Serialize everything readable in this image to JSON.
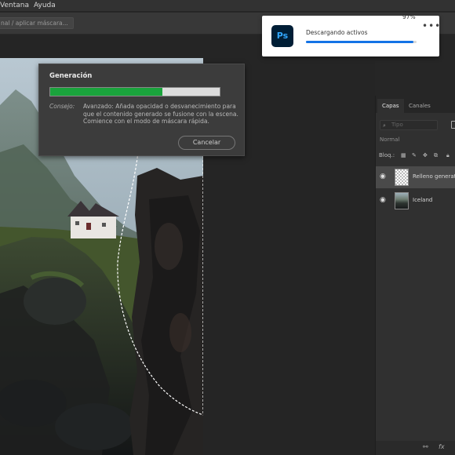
{
  "menubar": {
    "items": [
      "Ventana",
      "Ayuda"
    ]
  },
  "optionsbar": {
    "field_text": "nal / aplicar máscara..."
  },
  "generation_dialog": {
    "title": "Generación",
    "progress_percent": 66,
    "tip_label": "Consejo:",
    "tip_text": "Avanzado: Añada opacidad o desvanecimiento para que el contenido generado se fusione con la escena. Comience con el modo de máscara rápida.",
    "cancel_label": "Cancelar",
    "colors": {
      "progress": "#1aa33c"
    }
  },
  "download_card": {
    "app_logo_text": "Ps",
    "label": "Descargando activos",
    "percent_label": "97%",
    "progress_percent": 97,
    "more_icon": "ellipsis-icon",
    "colors": {
      "progress": "#1473e6",
      "logo_bg": "#001e36",
      "logo_fg": "#31a8ff"
    }
  },
  "layers_panel": {
    "tabs": [
      {
        "label": "Capas"
      },
      {
        "label": "Canales"
      }
    ],
    "filter_placeholder": "Tipo",
    "blend_mode": "Normal",
    "lock_label": "Bloq.:",
    "layers": [
      {
        "name": "Relleno generativo",
        "selected": true,
        "thumb": "checker"
      },
      {
        "name": "Iceland",
        "selected": false,
        "thumb": "photo"
      }
    ],
    "footer_icons": [
      "link-icon",
      "fx-icon"
    ],
    "footer_fx_label": "fx"
  }
}
